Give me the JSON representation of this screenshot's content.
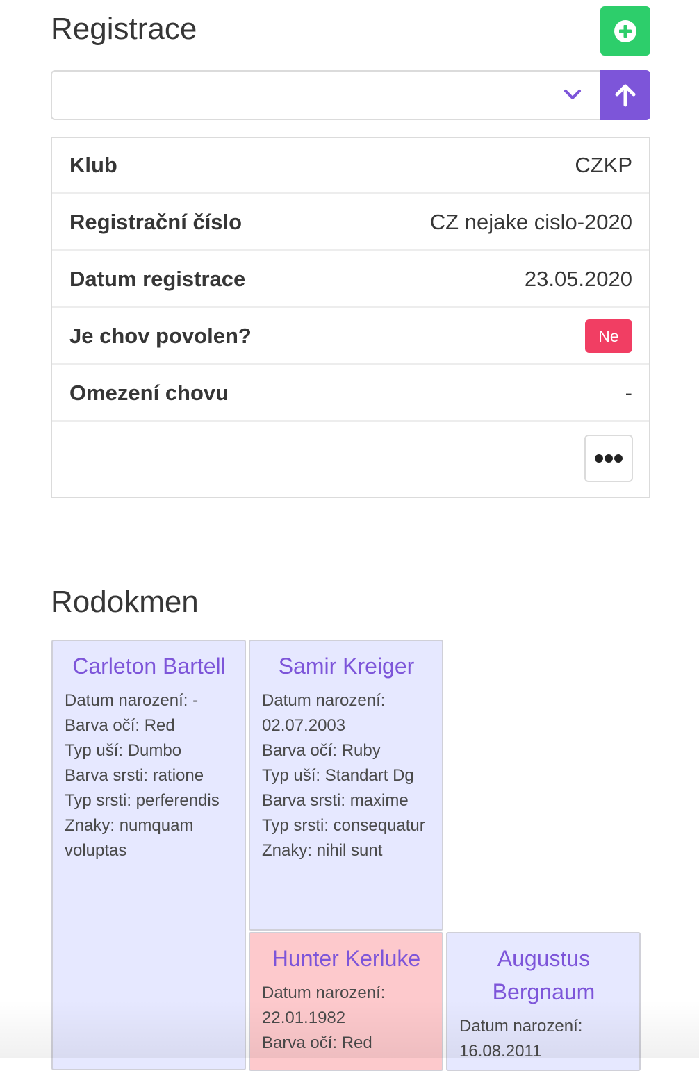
{
  "registration": {
    "title": "Registrace",
    "rows": [
      {
        "label": "Klub",
        "value": "CZKP"
      },
      {
        "label": "Registrační číslo",
        "value": "CZ nejake cislo-2020"
      },
      {
        "label": "Datum registrace",
        "value": "23.05.2020"
      },
      {
        "label": "Je chov povolen?",
        "value": "Ne"
      },
      {
        "label": "Omezení chovu",
        "value": "-"
      }
    ]
  },
  "pedigree": {
    "title": "Rodokmen",
    "cards": [
      {
        "name": "Carleton Bartell",
        "lines": [
          "Datum narození: -",
          "Barva očí: Red",
          "Typ uší: Dumbo",
          "Barva srsti: ratione",
          "Typ srsti: perferendis",
          "Znaky: numquam voluptas"
        ]
      },
      {
        "name": "Samir Kreiger",
        "lines": [
          "Datum narození: 02.07.2003",
          "Barva očí: Ruby",
          "Typ uší: Standart Dg",
          "Barva srsti: maxime",
          "Typ srsti: consequatur",
          "Znaky: nihil sunt"
        ]
      },
      {
        "name": "Hunter Kerluke",
        "lines": [
          "Datum narození: 22.01.1982",
          "Barva očí: Red"
        ]
      },
      {
        "name": "Augustus Bergnaum",
        "lines": [
          "Datum narození: 16.08.2011"
        ]
      }
    ]
  },
  "icons": {
    "add": "plus-circle-icon",
    "upload": "arrow-up-icon",
    "select": "chevron-down-icon",
    "more": "ellipsis-icon"
  },
  "colors": {
    "add_button": "#2dce6b",
    "accent": "#7d55d9",
    "badge_no": "#f13e63",
    "card_male": "#e6e8ff",
    "card_female": "#fdc9cc"
  }
}
